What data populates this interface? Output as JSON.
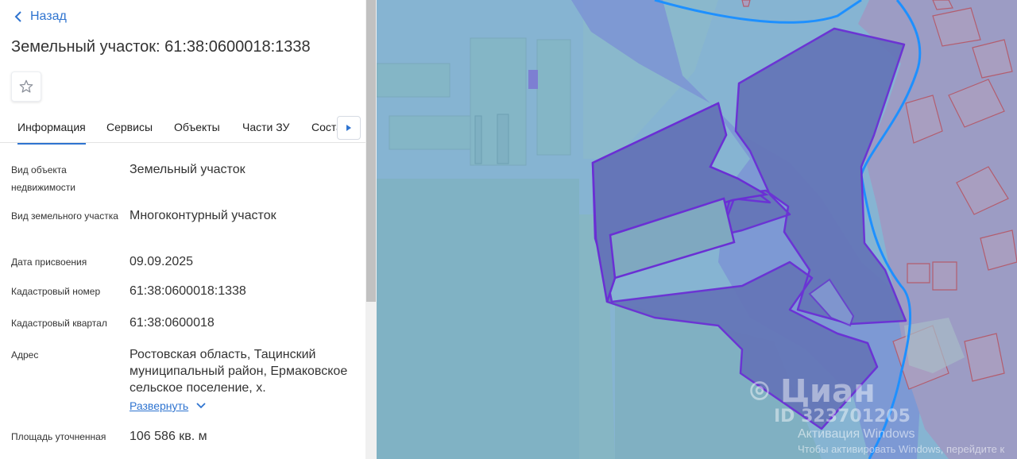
{
  "nav": {
    "back_label": "Назад"
  },
  "page": {
    "title": "Земельный участок: 61:38:0600018:1338"
  },
  "tabs": [
    {
      "label": "Информация",
      "active": true
    },
    {
      "label": "Сервисы"
    },
    {
      "label": "Объекты"
    },
    {
      "label": "Части ЗУ"
    },
    {
      "label": "Соста"
    }
  ],
  "details": {
    "object_type": {
      "label": "Вид объекта недвижимости",
      "value": "Земельный участок"
    },
    "land_type": {
      "label": "Вид земельного участка",
      "value": "Многоконтурный участок"
    },
    "assigned_date": {
      "label": "Дата присвоения",
      "value": "09.09.2025"
    },
    "cadastral_number": {
      "label": "Кадастровый номер",
      "value": "61:38:0600018:1338"
    },
    "cadastral_quarter": {
      "label": "Кадастровый квартал",
      "value": "61:38:0600018"
    },
    "address": {
      "label": "Адрес",
      "value": "Ростовская область, Тацинский муниципальный район, Ермаковское сельское поселение, х."
    },
    "area": {
      "label": "Площадь уточненная",
      "value": "106 586 кв. м"
    }
  },
  "expand_label": "Развернуть",
  "watermark": {
    "brand": "Циан",
    "id_text": "ID 323701205"
  },
  "windows_notice": {
    "line1": "Активация Windows",
    "line2": "Чтобы активировать Windows, перейдите к"
  },
  "colors": {
    "accent": "#2f74d0",
    "parcel_outline": "#6a2fd4",
    "boundary": "#1e90ff"
  },
  "icons": {
    "back": "chevron-left-icon",
    "favorite": "star-outline-icon",
    "tab_scroll": "caret-right-icon",
    "expand": "chevron-down-icon",
    "watermark": "map-pin-icon"
  }
}
